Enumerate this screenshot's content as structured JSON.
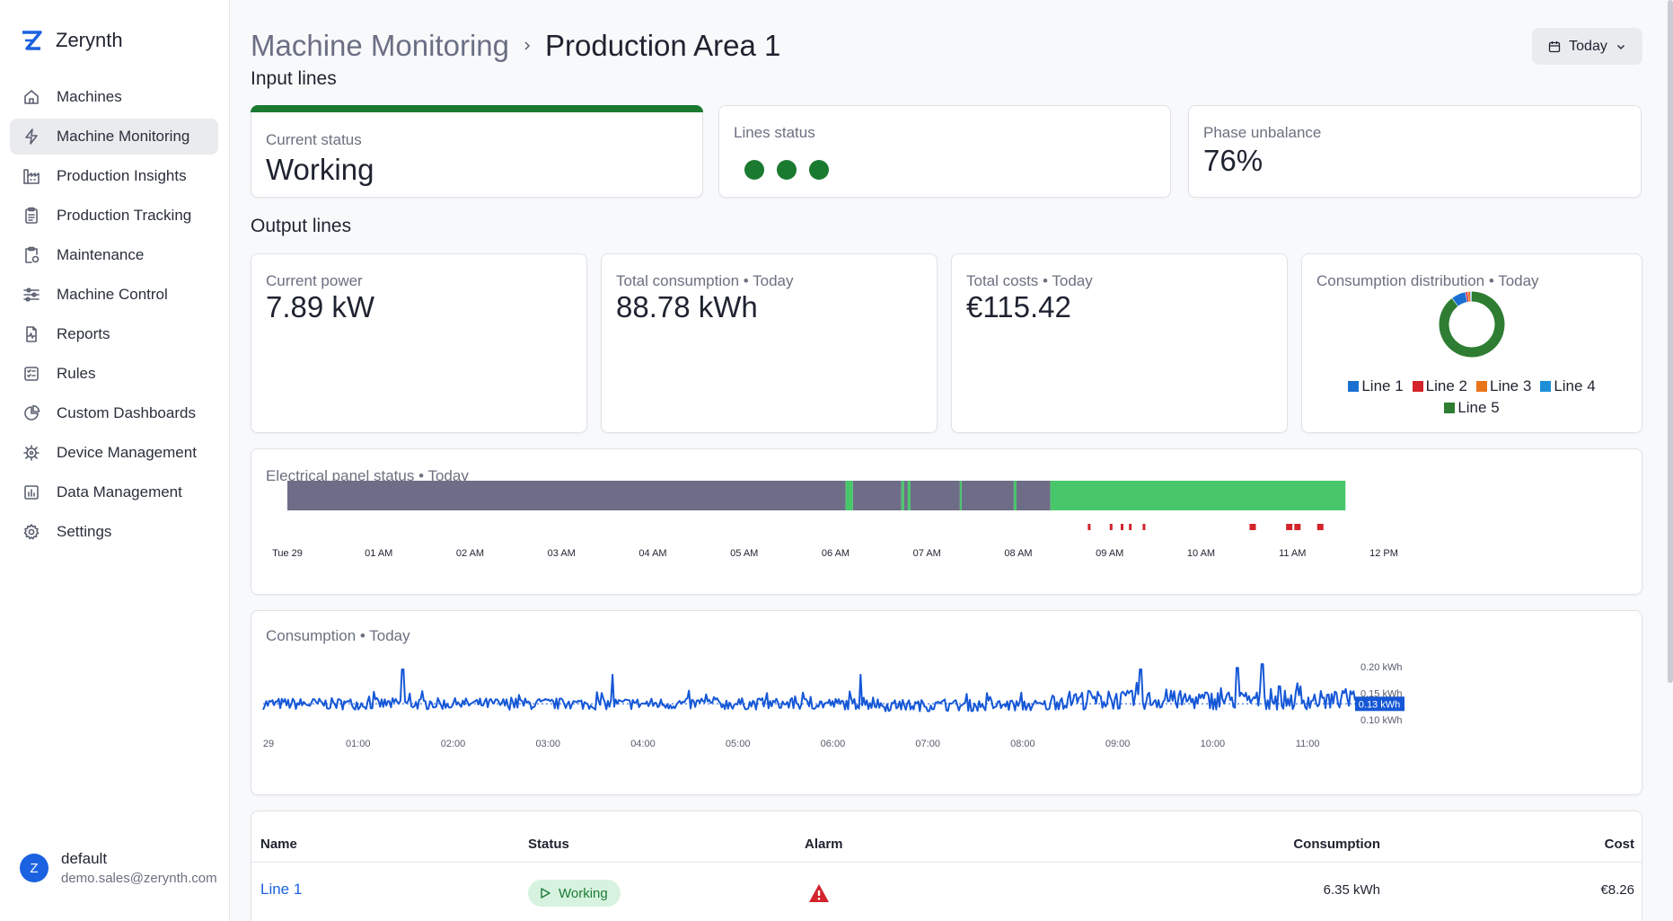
{
  "app": {
    "name": "Zerynth"
  },
  "sidebar": {
    "items": [
      {
        "label": "Machines",
        "icon": "home-icon"
      },
      {
        "label": "Machine Monitoring",
        "icon": "bolt-icon",
        "active": true
      },
      {
        "label": "Production Insights",
        "icon": "factory-icon"
      },
      {
        "label": "Production Tracking",
        "icon": "clipboard-list-icon"
      },
      {
        "label": "Maintenance",
        "icon": "clipboard-wrench-icon"
      },
      {
        "label": "Machine Control",
        "icon": "sliders-icon"
      },
      {
        "label": "Reports",
        "icon": "file-pulse-icon"
      },
      {
        "label": "Rules",
        "icon": "list-check-icon"
      },
      {
        "label": "Custom Dashboards",
        "icon": "pie-chart-icon"
      },
      {
        "label": "Device Management",
        "icon": "chip-icon"
      },
      {
        "label": "Data Management",
        "icon": "bar-chart-icon"
      },
      {
        "label": "Settings",
        "icon": "gear-icon"
      }
    ]
  },
  "user": {
    "initial": "Z",
    "name": "default",
    "email": "demo.sales@zerynth.com"
  },
  "header": {
    "breadcrumb_parent": "Machine Monitoring",
    "breadcrumb_current": "Production Area 1",
    "date_filter": "Today"
  },
  "input_lines": {
    "title": "Input lines",
    "current_status": {
      "label": "Current status",
      "value": "Working"
    },
    "lines_status": {
      "label": "Lines status",
      "dots": [
        "working",
        "working",
        "working"
      ]
    },
    "phase_unbalance": {
      "label": "Phase unbalance",
      "value": "76%"
    }
  },
  "output_lines": {
    "title": "Output lines",
    "current_power": {
      "label": "Current power",
      "value": "7.89 kW"
    },
    "total_consumption": {
      "label": "Total consumption • Today",
      "value": "88.78 kWh"
    },
    "total_costs": {
      "label": "Total costs • Today",
      "value": "€115.42"
    },
    "distribution_label": "Consumption distribution • Today"
  },
  "colors": {
    "working": "#1a7a30",
    "panel_idle": "#6e6d87",
    "panel_active": "#47c76a",
    "alarm": "#d3232b",
    "consumption_line": "#1557d6",
    "link": "#1b62e0"
  },
  "chart_data": [
    {
      "type": "pie",
      "title": "Consumption distribution • Today",
      "categories": [
        "Line 1",
        "Line 2",
        "Line 3",
        "Line 4",
        "Line 5"
      ],
      "values": [
        7.2,
        1.1,
        1.3,
        0.6,
        89.8
      ],
      "colors": [
        "#1b6fd1",
        "#d3232b",
        "#e8741a",
        "#1d8fd8",
        "#2e7d32"
      ],
      "legend": "bottom"
    },
    {
      "type": "timeline",
      "title": "Electrical panel status • Today",
      "x_ticks": [
        "Tue 29",
        "01 AM",
        "02 AM",
        "03 AM",
        "04 AM",
        "05 AM",
        "06 AM",
        "07 AM",
        "08 AM",
        "09 AM",
        "10 AM",
        "11 AM",
        "12 PM"
      ],
      "x_range_hours": [
        0,
        12
      ],
      "segments": [
        {
          "start": 0.0,
          "end": 6.11,
          "state": "idle"
        },
        {
          "start": 6.11,
          "end": 6.19,
          "state": "active"
        },
        {
          "start": 6.19,
          "end": 6.72,
          "state": "idle"
        },
        {
          "start": 6.72,
          "end": 6.75,
          "state": "active"
        },
        {
          "start": 6.75,
          "end": 6.79,
          "state": "idle"
        },
        {
          "start": 6.79,
          "end": 6.82,
          "state": "active"
        },
        {
          "start": 6.82,
          "end": 7.36,
          "state": "idle"
        },
        {
          "start": 7.36,
          "end": 7.38,
          "state": "active"
        },
        {
          "start": 7.38,
          "end": 7.95,
          "state": "idle"
        },
        {
          "start": 7.95,
          "end": 7.98,
          "state": "active"
        },
        {
          "start": 7.98,
          "end": 8.35,
          "state": "idle"
        },
        {
          "start": 8.35,
          "end": 11.58,
          "state": "active"
        }
      ],
      "alarms": [
        8.78,
        9.02,
        9.14,
        9.23,
        9.38,
        10.55,
        10.95,
        11.04,
        11.29
      ]
    },
    {
      "type": "line",
      "title": "Consumption • Today",
      "x_ticks": [
        "29",
        "01:00",
        "02:00",
        "03:00",
        "04:00",
        "05:00",
        "06:00",
        "07:00",
        "08:00",
        "09:00",
        "10:00",
        "11:00"
      ],
      "y_ticks": [
        "0.20 kWh",
        "0.15 kWh",
        "0.10 kWh"
      ],
      "y_tick_values": [
        0.2,
        0.15,
        0.1
      ],
      "ylim": [
        0.07,
        0.22
      ],
      "x_range_hours": [
        0,
        11.5
      ],
      "current_value_label": "0.13 kWh",
      "current_value": 0.13,
      "spikes": [
        {
          "h": 1.47,
          "v": 0.195
        },
        {
          "h": 3.68,
          "v": 0.185
        },
        {
          "h": 6.29,
          "v": 0.185
        },
        {
          "h": 9.24,
          "v": 0.195
        },
        {
          "h": 10.26,
          "v": 0.198
        },
        {
          "h": 10.52,
          "v": 0.205
        },
        {
          "h": 9.2,
          "v": 0.17
        },
        {
          "h": 10.7,
          "v": 0.163
        },
        {
          "h": 11.4,
          "v": 0.158
        }
      ]
    }
  ],
  "table": {
    "columns": [
      "Name",
      "Status",
      "Alarm",
      "Consumption",
      "Cost"
    ],
    "rows": [
      {
        "name": "Line 1",
        "status": "Working",
        "alarm": "warning",
        "consumption": "6.35 kWh",
        "cost": "€8.26"
      }
    ]
  }
}
